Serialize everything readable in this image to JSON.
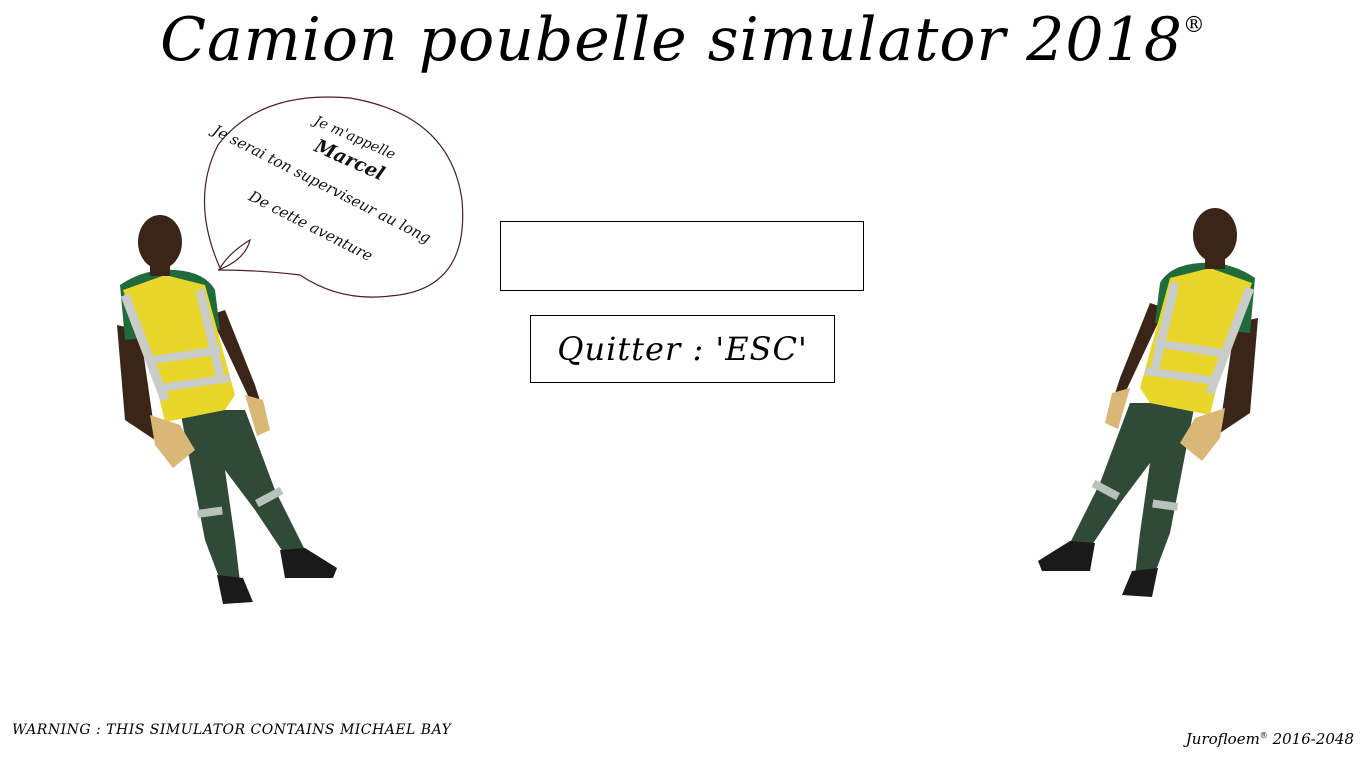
{
  "title": {
    "text": "Camion poubelle simulator 2018",
    "mark": "®"
  },
  "speech_bubble": {
    "line1": "Je m'appelle",
    "line2": "Marcel",
    "line3": "Je serai ton superviseur au long",
    "line4": "De cette aventure"
  },
  "input_field": {
    "value": ""
  },
  "quit_button": {
    "label": "Quitter : 'ESC'"
  },
  "footer": {
    "warning": "WARNING : THIS SIMULATOR CONTAINS MICHAEL BAY",
    "credit_name": "Jurofloem",
    "credit_mark": "®",
    "credit_years": "2016-2048"
  },
  "colors": {
    "vest": "#e9d62a",
    "shirt": "#1f6b3c",
    "pants": "#2f4a36",
    "gloves": "#d9b777",
    "skin": "#3b2418"
  }
}
